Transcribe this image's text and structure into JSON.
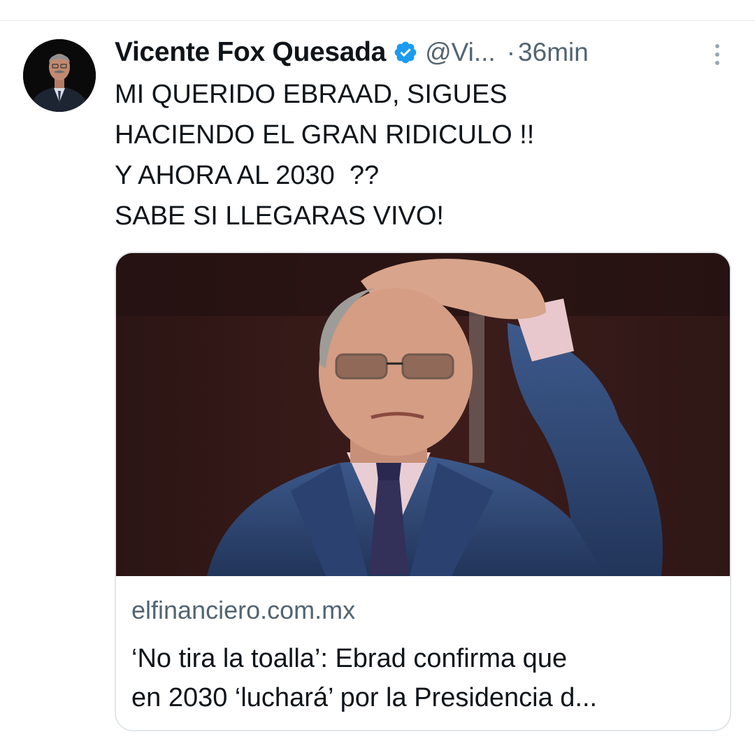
{
  "tweet": {
    "author_name": "Vicente Fox Quesada",
    "handle": "@Vi...",
    "separator": "·",
    "time": "36min",
    "text": "MI QUERIDO EBRAAD, SIGUES\nHACIENDO EL GRAN RIDICULO !!\nY AHORA AL 2030  ??\nSABE SI LLEGARAS VIVO!",
    "verified_icon": "verified-badge-icon",
    "more_icon": "more-options-icon"
  },
  "link_card": {
    "domain": "elfinanciero.com.mx",
    "title": "‘No tira la toalla’: Ebrad confirma que\nen 2030 ‘luchará’ por la Presidencia d..."
  },
  "colors": {
    "text_primary": "#0f1419",
    "text_secondary": "#536471",
    "verified_blue": "#1d9bf0",
    "border": "#e1e6ea"
  }
}
